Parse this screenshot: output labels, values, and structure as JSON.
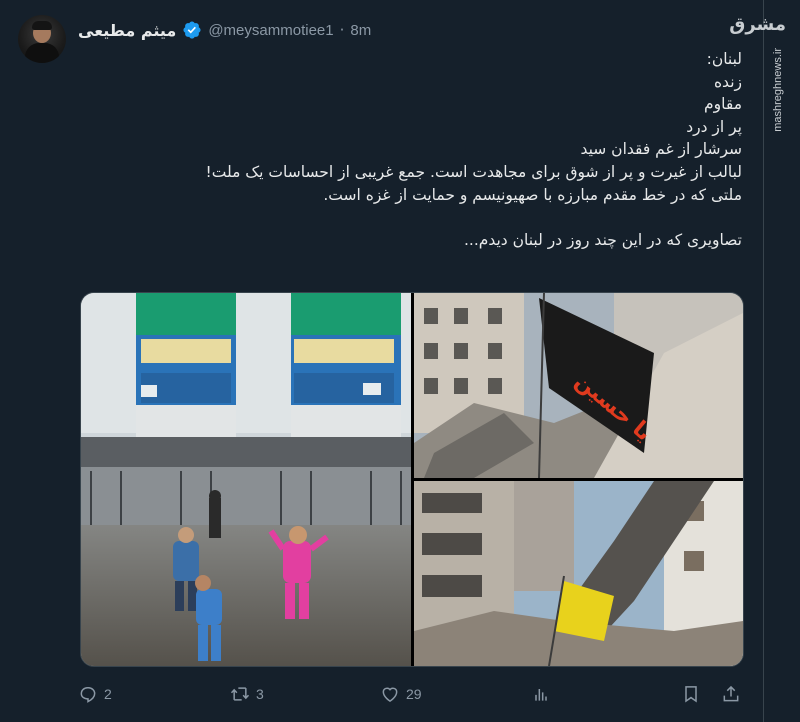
{
  "tweet": {
    "display_name": "میثم مطیعی",
    "handle": "@meysammotiee1",
    "separator": "·",
    "time": "8m",
    "lines": [
      "لبنان:",
      "زنده",
      "مقاوم",
      "پر از درد",
      "سرشار از غم فقدان سید",
      "لبالب از غیرت و پر از شوق برای مجاهدت است. جمع غریبی از احساسات یک ملت!",
      "ملتی که در خط مقدم مبارزه با صهیونیسم و حمایت از غزه است.",
      "",
      "تصاویری که در این چند روز در لبنان دیدم..."
    ],
    "stats": {
      "replies": "2",
      "retweets": "3",
      "likes": "29"
    }
  },
  "watermark": {
    "logo": "مشرق",
    "url": "mashreghnews.ir"
  },
  "photos": {
    "flag_text": "یا حسین"
  },
  "icons": {
    "verified": "verified-badge-icon",
    "reply": "reply-icon",
    "retweet": "retweet-icon",
    "like": "heart-icon",
    "views": "analytics-icon",
    "bookmark": "bookmark-icon",
    "share": "share-icon"
  },
  "colors": {
    "background": "#15202b",
    "text": "#e7e9ea",
    "muted": "#8b98a5",
    "verified": "#1d9bf0"
  }
}
